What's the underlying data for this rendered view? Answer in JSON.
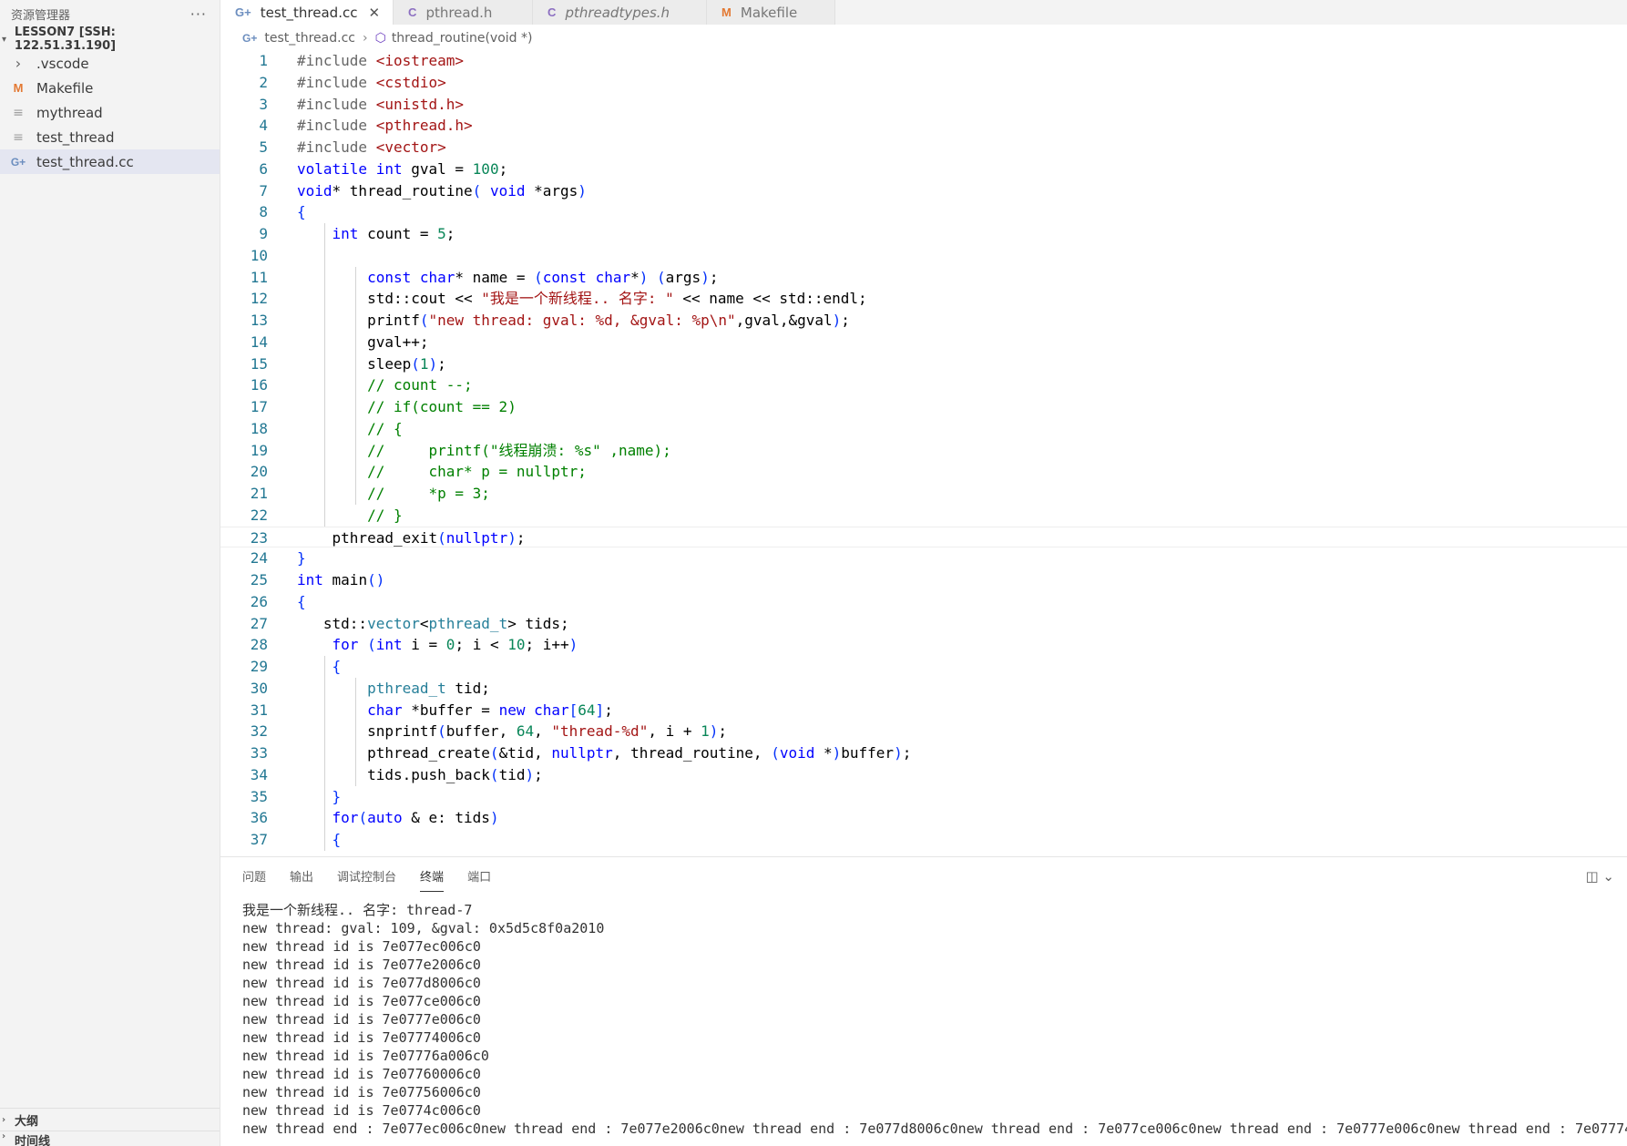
{
  "sidebar": {
    "header": "资源管理器",
    "more": "···",
    "root": "LESSON7 [SSH: 122.51.31.190]",
    "items": [
      {
        "label": ".vscode",
        "icon": "chevron-right-icon"
      },
      {
        "label": "Makefile",
        "icon": "makefile-icon"
      },
      {
        "label": "mythread",
        "icon": "file-icon"
      },
      {
        "label": "test_thread",
        "icon": "file-icon"
      },
      {
        "label": "test_thread.cc",
        "icon": "cpp-file-icon",
        "selected": true
      }
    ],
    "outline": "大纲",
    "timeline": "时间线"
  },
  "tabs": [
    {
      "label": "test_thread.cc",
      "icon": "C++",
      "active": true
    },
    {
      "label": "pthread.h",
      "icon": "C"
    },
    {
      "label": "pthreadtypes.h",
      "icon": "C",
      "italic": true
    },
    {
      "label": "Makefile",
      "icon": "M"
    }
  ],
  "breadcrumb": {
    "file": "test_thread.cc",
    "symbol": "thread_routine(void *)"
  },
  "code": [
    "#include <iostream>",
    "#include <cstdio>",
    "#include <unistd.h>",
    "#include <pthread.h>",
    "#include <vector>",
    "volatile int gval = 100;",
    "void* thread_routine( void *args)",
    "{",
    "    int count = 5;",
    "",
    "        const char* name = (const char*) (args);",
    "        std::cout << \"我是一个新线程.. 名字: \" << name << std::endl;",
    "        printf(\"new thread: gval: %d, &gval: %p\\n\",gval,&gval);",
    "        gval++;",
    "        sleep(1);",
    "        // count --;",
    "        // if(count == 2)",
    "        // {",
    "        //     printf(\"线程崩溃: %s\" ,name);",
    "        //     char* p = nullptr;",
    "        //     *p = 3;",
    "        // }",
    "    pthread_exit(nullptr);",
    "}",
    "int main()",
    "{",
    "   std::vector<pthread_t> tids;",
    "    for (int i = 0; i < 10; i++)",
    "    {",
    "        pthread_t tid;",
    "        char *buffer = new char[64];",
    "        snprintf(buffer, 64, \"thread-%d\", i + 1);",
    "        pthread_create(&tid, nullptr, thread_routine, (void *)buffer);",
    "        tids.push_back(tid);",
    "    }",
    "    for(auto & e: tids)",
    "    {"
  ],
  "panel": {
    "tabs": [
      "问题",
      "输出",
      "调试控制台",
      "终端",
      "端口"
    ],
    "active_tab": "终端",
    "terminal": [
      "我是一个新线程.. 名字: thread-7",
      "new thread: gval: 109, &gval: 0x5d5c8f0a2010",
      "new thread id is 7e077ec006c0",
      "new thread id is 7e077e2006c0",
      "new thread id is 7e077d8006c0",
      "new thread id is 7e077ce006c0",
      "new thread id is 7e0777e006c0",
      "new thread id is 7e07774006c0",
      "new thread id is 7e07776a006c0",
      "new thread id is 7e07760006c0",
      "new thread id is 7e07756006c0",
      "new thread id is 7e0774c006c0",
      "new thread end : 7e077ec006c0new thread end : 7e077e2006c0new thread end : 7e077d8006c0new thread end : 7e077ce006c0new thread end : 7e0777e006c0new thread end : 7e07774"
    ]
  }
}
